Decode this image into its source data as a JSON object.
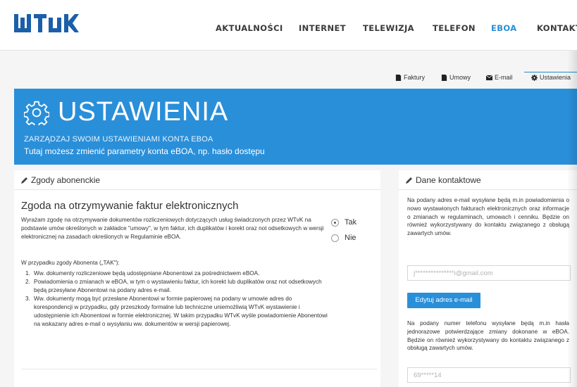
{
  "header": {
    "logo_text": "WTvK",
    "nav": [
      {
        "label": "AKTUALNOŚCI",
        "active": false
      },
      {
        "label": "INTERNET",
        "active": false
      },
      {
        "label": "TELEWIZJA",
        "active": false
      },
      {
        "label": "TELEFON",
        "active": false
      },
      {
        "label": "EBOA",
        "active": true
      },
      {
        "label": "KONTAKT",
        "active": false
      }
    ]
  },
  "subtabs": [
    {
      "label": "Faktury",
      "icon": "file-icon"
    },
    {
      "label": "Umowy",
      "icon": "document-icon"
    },
    {
      "label": "E-mail",
      "icon": "envelope-icon"
    },
    {
      "label": "Ustawienia",
      "icon": "gear-icon",
      "active": true
    }
  ],
  "banner": {
    "title": "USTAWIENIA",
    "subtitle": "ZARZĄDZAJ SWOIM USTAWIENIAMI KONTA EBOA",
    "description": "Tutaj możesz zmienić parametry konta eBOA, np. hasło dostępu",
    "color": "#2a8fd9"
  },
  "consents": {
    "heading": "Zgody abonenckie",
    "title": "Zgoda na otrzymywanie faktur elektronicznych",
    "body": "Wyrażam zgodę na otrzymywanie dokumentów rozliczeniowych dotyczących usług świadczonych przez WTvK na podstawie umów określonych w zakładce \"umowy\", w tym faktur, ich duplikatów i korekt oraz not odsetkowych w wersji elektronicznej na zasadach określonych w Regulaminie eBOA.",
    "if_label": "W przypadku zgody Abonenta („TAK\"):",
    "list": [
      "Ww. dokumenty rozliczeniowe będą udostępniane Abonentowi za pośrednictwem eBOA.",
      "Powiadomienia o zmianach w eBOA, w tym o wystawieniu faktur, ich korekt lub duplikatów oraz not odsetkowych będą przesyłane Abonentowi na podany adres e-mail.",
      "Ww. dokumenty mogą być przesłane Abonentowi w formie papierowej na podany w umowie adres do korespondencji w przypadku, gdy przeszkody formalne lub techniczne uniemożliwią WTvK wystawienie i udostępnienie ich Abonentowi w formie elektronicznej. W takim przypadku WTvK wyśle powiadomienie Abonentowi na wskazany adres e-mail o wysyłaniu ww. dokumentów w wersji papierowej."
    ],
    "options": [
      {
        "label": "Tak",
        "selected": true
      },
      {
        "label": "Nie",
        "selected": false
      }
    ]
  },
  "contact": {
    "heading": "Dane kontaktowe",
    "email_info": "Na podany adres e-mail wysyłane będą m.in powiadomienia o nowo wystawionych fakturach elektronicznych oraz informacje o zmianach w regulaminach, umowach i cenniku. Będzie on również wykorzystywany do kontaktu związanego z obsługą zawartych umów.",
    "email_value": "j***************i@gmail.com",
    "edit_email_label": "Edytuj adres e-mail",
    "phone_info": "Na podany numer telefonu wysyłane będą m.in hasła jednorazowe potwierdzające zmiany dokonane w eBOA. Będzie on również wykorzystywany do kontaktu związanego z obsługą zawartych umów.",
    "phone_value": "69*****14"
  }
}
